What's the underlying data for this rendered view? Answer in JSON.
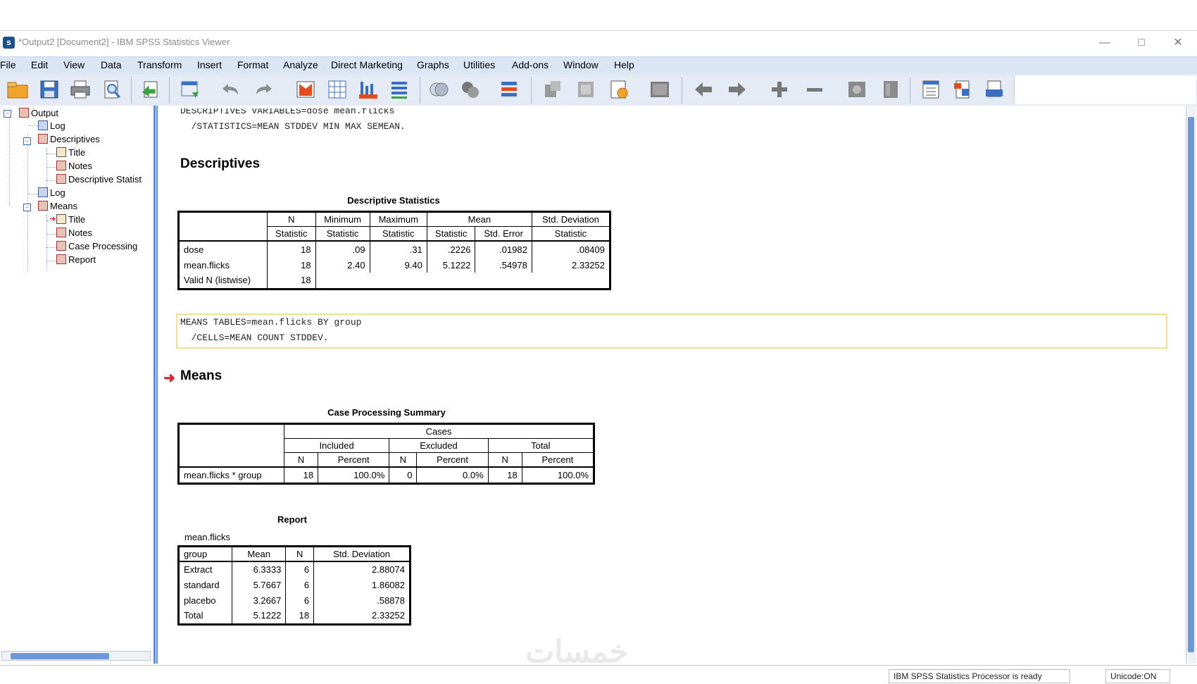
{
  "window": {
    "title": "*Output2 [Document2] - IBM SPSS Statistics Viewer"
  },
  "menu": [
    "File",
    "Edit",
    "View",
    "Data",
    "Transform",
    "Insert",
    "Format",
    "Analyze",
    "Direct Marketing",
    "Graphs",
    "Utilities",
    "Add-ons",
    "Window",
    "Help"
  ],
  "toolbar_icons": [
    "open-icon",
    "save-icon",
    "print-icon",
    "print-preview-icon",
    "export-icon",
    "recall-dialog-icon",
    "undo-icon",
    "redo-icon",
    "goto-case-icon",
    "goto-variable-icon",
    "insert-variable-icon",
    "variables-icon",
    "designate-window-icon",
    "select-cases-icon",
    "weight-icon",
    "split-file-icon",
    "chart-icon",
    "edit-table-icon",
    "run-icon",
    "hide-icon",
    "back-icon",
    "forward-icon",
    "expand-icon",
    "collapse-icon",
    "show-icon",
    "hide-all-icon",
    "insert-heading-icon",
    "insert-title-icon",
    "insert-text-icon"
  ],
  "nav": {
    "items": [
      {
        "label": "Output",
        "level": 0,
        "icon": "output-book-icon"
      },
      {
        "label": "Log",
        "level": 1,
        "icon": "log-icon"
      },
      {
        "label": "Descriptives",
        "level": 1,
        "icon": "procedure-book-icon"
      },
      {
        "label": "Title",
        "level": 2,
        "icon": "title-icon"
      },
      {
        "label": "Notes",
        "level": 2,
        "icon": "notes-icon"
      },
      {
        "label": "Descriptive Statist",
        "level": 2,
        "icon": "table-icon"
      },
      {
        "label": "Log",
        "level": 1,
        "icon": "log-icon"
      },
      {
        "label": "Means",
        "level": 1,
        "icon": "procedure-book-icon"
      },
      {
        "label": "Title",
        "level": 2,
        "icon": "title-icon"
      },
      {
        "label": "Notes",
        "level": 2,
        "icon": "notes-icon"
      },
      {
        "label": "Case Processing",
        "level": 2,
        "icon": "table-icon"
      },
      {
        "label": "Report",
        "level": 2,
        "icon": "table-icon"
      }
    ]
  },
  "syntax1": {
    "line1": "DESCRIPTIVES VARIABLES=dose mean.flicks",
    "line2": "  /STATISTICS=MEAN STDDEV MIN MAX SEMEAN."
  },
  "descriptives": {
    "heading": "Descriptives",
    "table_title": "Descriptive Statistics",
    "col_groups": [
      "N",
      "Minimum",
      "Maximum",
      "Mean",
      "Std. Deviation"
    ],
    "subcols": [
      "Statistic",
      "Statistic",
      "Statistic",
      "Statistic",
      "Std. Error",
      "Statistic"
    ],
    "rows": [
      {
        "label": "dose",
        "cells": [
          "18",
          ".09",
          ".31",
          ".2226",
          ".01982",
          ".08409"
        ]
      },
      {
        "label": "mean.flicks",
        "cells": [
          "18",
          "2.40",
          "9.40",
          "5.1222",
          ".54978",
          "2.33252"
        ]
      },
      {
        "label": "Valid N (listwise)",
        "cells": [
          "18",
          "",
          "",
          "",
          "",
          ""
        ]
      }
    ]
  },
  "syntax2": {
    "line1": "MEANS TABLES=mean.flicks BY group",
    "line2": "  /CELLS=MEAN COUNT STDDEV."
  },
  "means": {
    "heading": "Means",
    "case_title": "Case Processing Summary",
    "case_group": "Cases",
    "case_subgroups": [
      "Included",
      "Excluded",
      "Total"
    ],
    "case_cols": [
      "N",
      "Percent",
      "N",
      "Percent",
      "N",
      "Percent"
    ],
    "case_row": {
      "label": "mean.flicks * group",
      "cells": [
        "18",
        "100.0%",
        "0",
        "0.0%",
        "18",
        "100.0%"
      ]
    },
    "report_title": "Report",
    "report_var": "mean.flicks",
    "report_cols": [
      "group",
      "Mean",
      "N",
      "Std. Deviation"
    ],
    "report_rows": [
      {
        "label": "Extract",
        "cells": [
          "6.3333",
          "6",
          "2.88074"
        ]
      },
      {
        "label": "standard",
        "cells": [
          "5.7667",
          "6",
          "1.86082"
        ]
      },
      {
        "label": "placebo",
        "cells": [
          "3.2667",
          "6",
          ".58878"
        ]
      },
      {
        "label": "Total",
        "cells": [
          "5.1222",
          "18",
          "2.33252"
        ]
      }
    ]
  },
  "status": {
    "processor": "IBM SPSS Statistics Processor is ready",
    "unicode": "Unicode:ON"
  },
  "watermark": "خمسات"
}
